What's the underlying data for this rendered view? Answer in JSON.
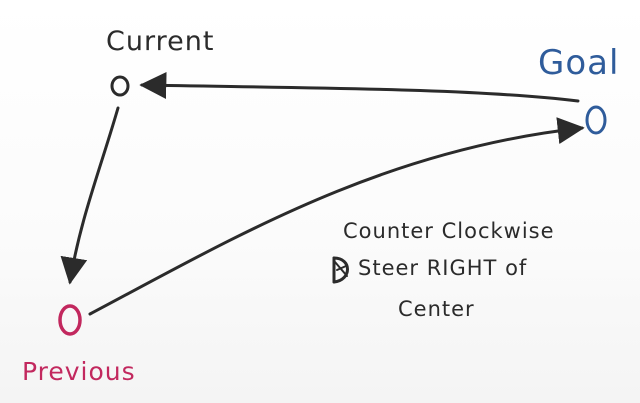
{
  "nodes": {
    "current": {
      "label": "Current",
      "color": "#2b2b2b"
    },
    "goal": {
      "label": "Goal",
      "color": "#2f5c9b"
    },
    "previous": {
      "label": "Previous",
      "color": "#c2285e"
    }
  },
  "note": {
    "line1": "Counter Clockwise",
    "line2": "Steer RIGHT of",
    "line3": "Center"
  },
  "colors": {
    "marker_black": "#2b2b2b",
    "marker_blue": "#2f5c9b",
    "marker_pink": "#c2285e"
  }
}
